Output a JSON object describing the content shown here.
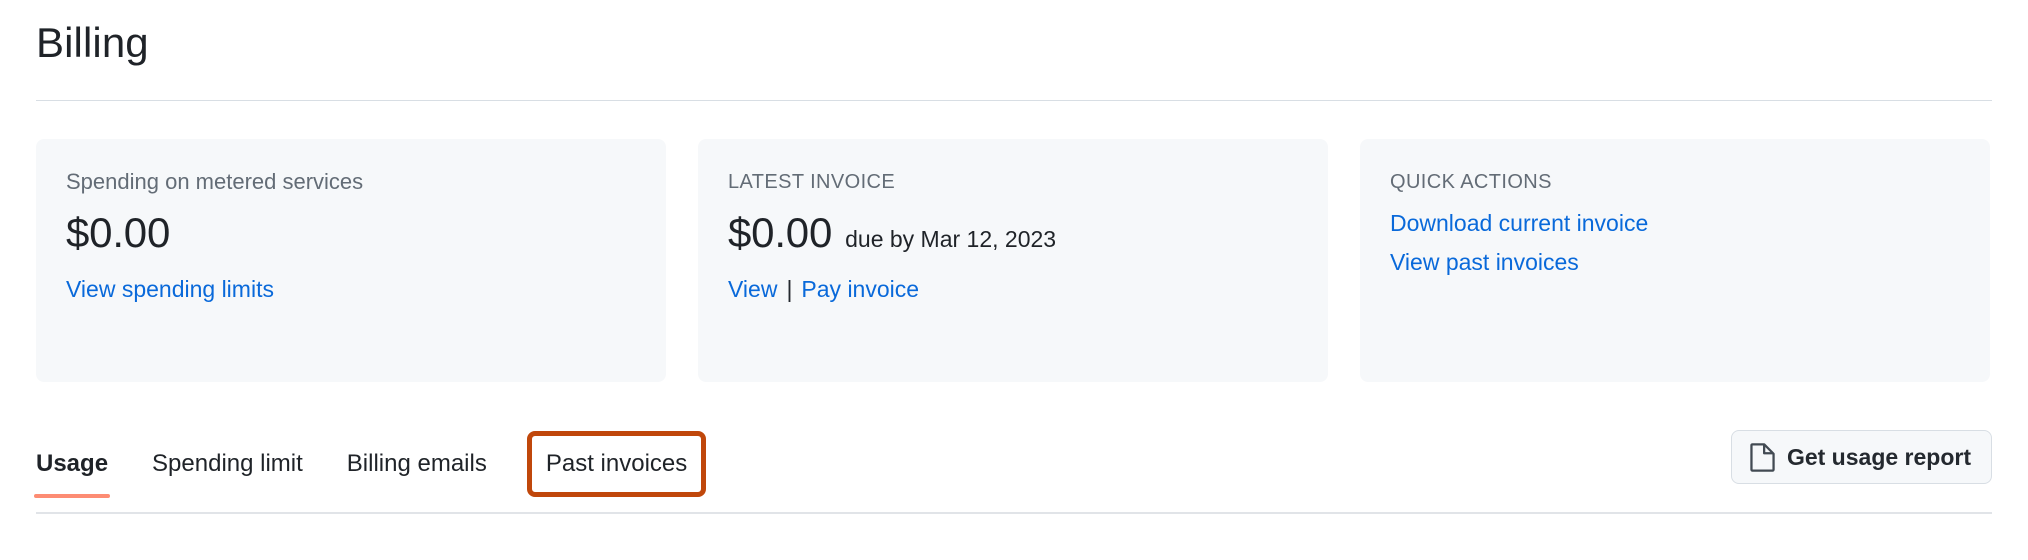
{
  "header": {
    "title": "Billing"
  },
  "cards": [
    {
      "id": "metered-spending",
      "label": "Spending on metered services",
      "amount": "$0.00",
      "amount_suffix": "",
      "links": [
        {
          "id": "view-spending-limits",
          "label": "View spending limits"
        }
      ]
    },
    {
      "id": "latest-invoice",
      "label": "LATEST INVOICE",
      "amount": "$0.00",
      "amount_suffix": "due by Mar 12, 2023",
      "links": [
        {
          "id": "view-invoice",
          "label": "View"
        },
        {
          "id": "pay-invoice",
          "label": "Pay invoice"
        }
      ],
      "separator": "|"
    },
    {
      "id": "quick-actions",
      "label": "QUICK ACTIONS",
      "links": [
        {
          "id": "download-current-invoice",
          "label": "Download current invoice"
        },
        {
          "id": "view-past-invoices",
          "label": "View past invoices"
        }
      ]
    }
  ],
  "tabs": [
    {
      "id": "usage",
      "label": "Usage",
      "active": true,
      "highlighted": false
    },
    {
      "id": "spending-limit",
      "label": "Spending limit",
      "active": false,
      "highlighted": false
    },
    {
      "id": "billing-emails",
      "label": "Billing emails",
      "active": false,
      "highlighted": false
    },
    {
      "id": "past-invoices",
      "label": "Past invoices",
      "active": false,
      "highlighted": true
    }
  ],
  "actions": {
    "usage_report_label": "Get usage report",
    "usage_report_icon": "file-icon"
  },
  "colors": {
    "link": "#0969DA",
    "active_tab_underline": "#FD8C73",
    "highlight_border": "#C0470B",
    "card_background": "#F6F8FA",
    "muted_text": "#636C76",
    "text": "#1F2328",
    "divider": "#D8DEE4"
  }
}
